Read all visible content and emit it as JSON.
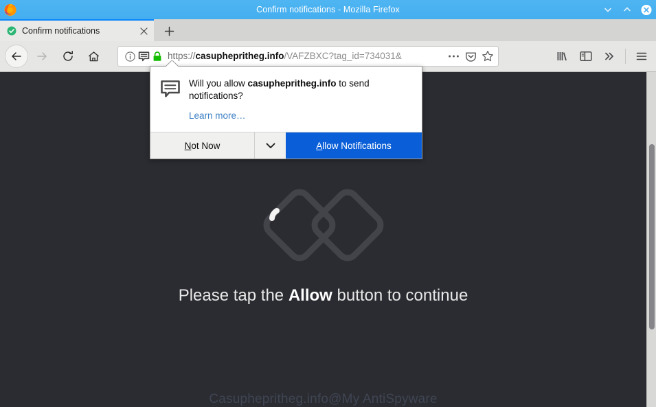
{
  "window": {
    "title": "Confirm notifications - Mozilla Firefox",
    "minimize_label": "Minimize",
    "maximize_label": "Maximize",
    "close_label": "Close"
  },
  "tabs": {
    "items": [
      {
        "label": "Confirm notifications",
        "favicon": "green-check-circle-icon",
        "close_label": "Close tab"
      }
    ],
    "new_tab_label": "Open a new tab"
  },
  "toolbar": {
    "back_label": "Go back one page",
    "forward_label": "Go forward one page",
    "reload_label": "Reload current page",
    "home_label": "Home",
    "library_label": "Library",
    "sidebar_label": "Sidebar",
    "overflow_label": "More tools",
    "menu_label": "Open menu"
  },
  "urlbar": {
    "scheme": "https://",
    "domain": "casuphepritheg.info",
    "path": "/VAFZBXC?tag_id=734031&",
    "full_url": "https://casuphepritheg.info/VAFZBXC?tag_id=734031&",
    "identity_icon": "info-circle-icon",
    "notification_icon": "speech-bubble-icon",
    "lock_icon": "padlock-icon",
    "lock_color": "#12bc00",
    "page_actions_label": "Page actions",
    "pocket_label": "Save to Pocket",
    "bookmark_label": "Bookmark this page"
  },
  "doorhanger": {
    "icon": "speech-bubble-icon",
    "question_prefix": "Will you allow ",
    "question_host": "casuphepritheg.info",
    "question_suffix": " to send notifications?",
    "learn_more": "Learn more…",
    "secondary_button": {
      "prefix": "N",
      "rest": "ot Now"
    },
    "dropdown_icon": "chevron-down-icon",
    "primary_button": {
      "prefix": "A",
      "rest": "llow Notifications"
    },
    "primary_color": "#0a5fd8"
  },
  "page": {
    "spinner_icon": "double-diamond-loading-icon",
    "tap_prefix": "Please tap the ",
    "tap_bold": "Allow",
    "tap_suffix": " button to continue",
    "footer": "Casuphepritheg.info@My AntiSpyware",
    "background_color": "#2b2c31"
  }
}
